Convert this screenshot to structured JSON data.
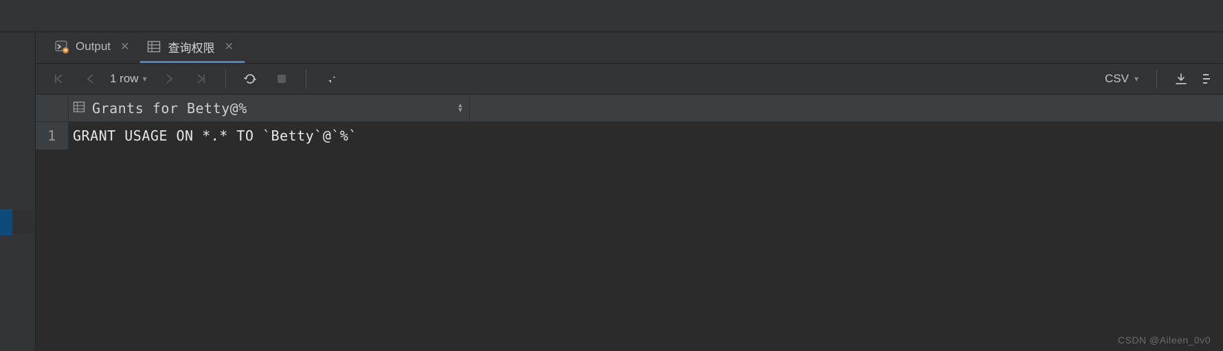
{
  "tabs": {
    "output": {
      "label": "Output"
    },
    "query": {
      "label": "查询权限"
    }
  },
  "toolbar": {
    "rowcount_label": "1 row",
    "csv_label": "CSV"
  },
  "table": {
    "column_header": "Grants for Betty@%",
    "rows": [
      {
        "num": "1",
        "value": "GRANT USAGE ON *.* TO `Betty`@`%`"
      }
    ]
  },
  "watermark": "CSDN @Aileen_0v0"
}
